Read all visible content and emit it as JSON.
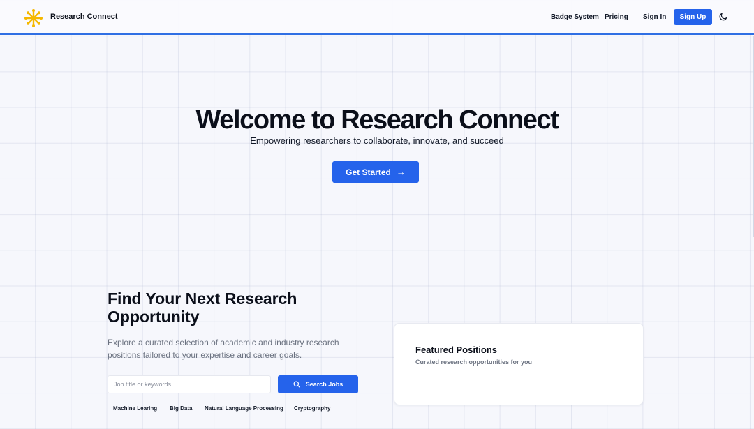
{
  "header": {
    "brand": "Research Connect",
    "nav": {
      "badge_system": "Badge System",
      "pricing": "Pricing",
      "sign_in": "Sign In",
      "sign_up": "Sign Up"
    },
    "logo_icon": "asterisk-spark-icon",
    "theme_icon": "moon-icon"
  },
  "hero": {
    "title": "Welcome to Research Connect",
    "subtitle": "Empowering researchers to collaborate, innovate, and succeed",
    "cta_label": "Get Started",
    "cta_icon": "→"
  },
  "search_section": {
    "title": "Find Your Next Research Opportunity",
    "description": "Explore a curated selection of academic and industry research positions tailored to your expertise and career goals.",
    "search": {
      "placeholder": "Job title or keywords",
      "value": "",
      "button_label": "Search Jobs"
    },
    "tags": [
      "Machine Learing",
      "Big Data",
      "Natural Language Processing",
      "Cryptography"
    ]
  },
  "featured": {
    "title": "Featured Positions",
    "subtitle": "Curated research opportunities for you"
  },
  "colors": {
    "accent": "#2563eb",
    "logo": "#f5b800",
    "header_border": "#2f6fe4"
  }
}
